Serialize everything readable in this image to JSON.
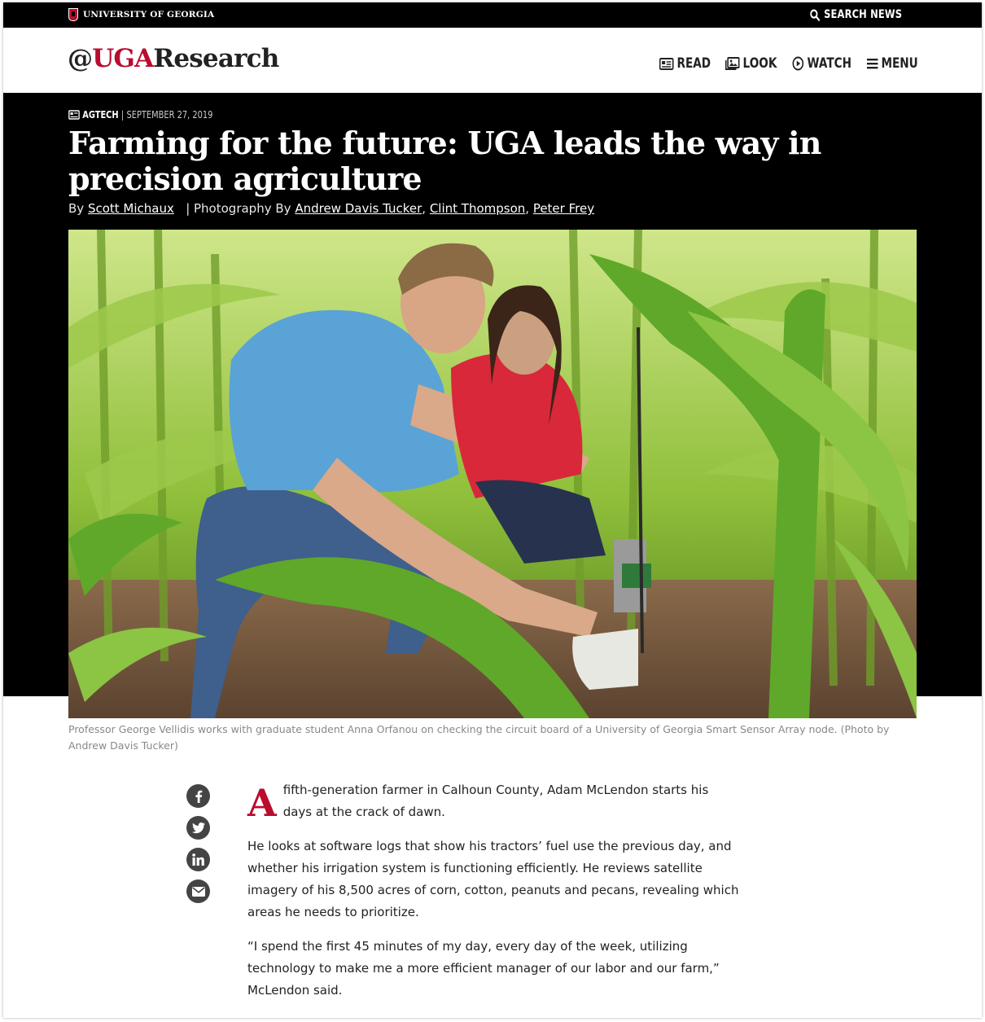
{
  "topbar": {
    "university_name": "UNIVERSITY OF GEORGIA",
    "search_label": "SEARCH NEWS"
  },
  "header": {
    "logo_prefix": "@",
    "logo_uga": "UGA",
    "logo_suffix": "Research",
    "nav": {
      "read": "READ",
      "look": "LOOK",
      "watch": "WATCH",
      "menu": "MENU"
    }
  },
  "article_meta": {
    "category": "AGTECH",
    "separator": "|",
    "date": "SEPTEMBER 27, 2019"
  },
  "headline": "Farming for the future: UGA leads the way in precision agriculture",
  "byline": {
    "by": "By",
    "author": "Scott Michaux",
    "photo_prefix": "| Photography By",
    "photographers": [
      "Andrew Davis Tucker",
      "Clint Thompson",
      "Peter Frey"
    ]
  },
  "caption": "Professor George Vellidis works with graduate student Anna Orfanou on checking the circuit board of a University of Georgia Smart Sensor Array node. (Photo by Andrew Davis Tucker)",
  "share": {
    "icons": [
      "facebook-icon",
      "twitter-icon",
      "linkedin-icon",
      "email-icon"
    ]
  },
  "article": {
    "dropcap": "A",
    "p1_rest": "fifth-generation farmer in Calhoun County, Adam McLendon starts his days at the crack of dawn.",
    "p2": "He looks at software logs that show his tractors’ fuel use the previous day, and whether his irrigation system is functioning efficiently. He reviews satellite imagery of his 8,500 acres of corn, cotton, peanuts and pecans, revealing which areas he needs to prioritize.",
    "p3": "“I spend the first 45 minutes of my day, every day of the week, utilizing technology to make me a more efficient manager of our labor and our farm,” McLendon said."
  },
  "colors": {
    "brand_red": "#ba0c2f",
    "hero_bg": "#000000",
    "share_gray": "#444444"
  }
}
